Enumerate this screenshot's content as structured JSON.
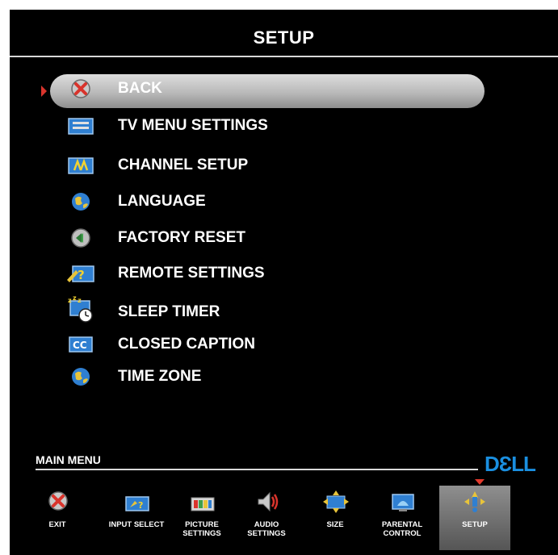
{
  "header": {
    "title": "SETUP"
  },
  "menu": {
    "items": [
      {
        "label": "BACK",
        "icon": "back-x-icon",
        "selected": true
      },
      {
        "label": "TV MENU SETTINGS",
        "icon": "tv-menu-icon"
      },
      {
        "label": "CHANNEL SETUP",
        "icon": "channel-setup-icon"
      },
      {
        "label": "LANGUAGE",
        "icon": "globe-icon"
      },
      {
        "label": "FACTORY RESET",
        "icon": "factory-reset-icon"
      },
      {
        "label": "REMOTE SETTINGS",
        "icon": "remote-settings-icon"
      },
      {
        "label": "SLEEP TIMER",
        "icon": "sleep-timer-icon"
      },
      {
        "label": "CLOSED CAPTION",
        "icon": "cc-icon"
      },
      {
        "label": "TIME ZONE",
        "icon": "globe-icon"
      }
    ]
  },
  "main_menu": {
    "label": "MAIN MENU",
    "logo": "DƐLL",
    "items": [
      {
        "label": "EXIT",
        "icon": "exit-icon"
      },
      {
        "label": "INPUT SELECT",
        "icon": "input-select-icon"
      },
      {
        "label": "PICTURE SETTINGS",
        "icon": "picture-settings-icon"
      },
      {
        "label": "AUDIO SETTINGS",
        "icon": "speaker-icon"
      },
      {
        "label": "SIZE",
        "icon": "size-icon"
      },
      {
        "label": "PARENTAL CONTROL",
        "icon": "parental-control-icon"
      },
      {
        "label": "SETUP",
        "icon": "setup-icon",
        "selected": true
      }
    ]
  },
  "colors": {
    "accent_red": "#d9342c",
    "dell_blue": "#1a8fe0",
    "icon_blue": "#2f7fd1"
  }
}
